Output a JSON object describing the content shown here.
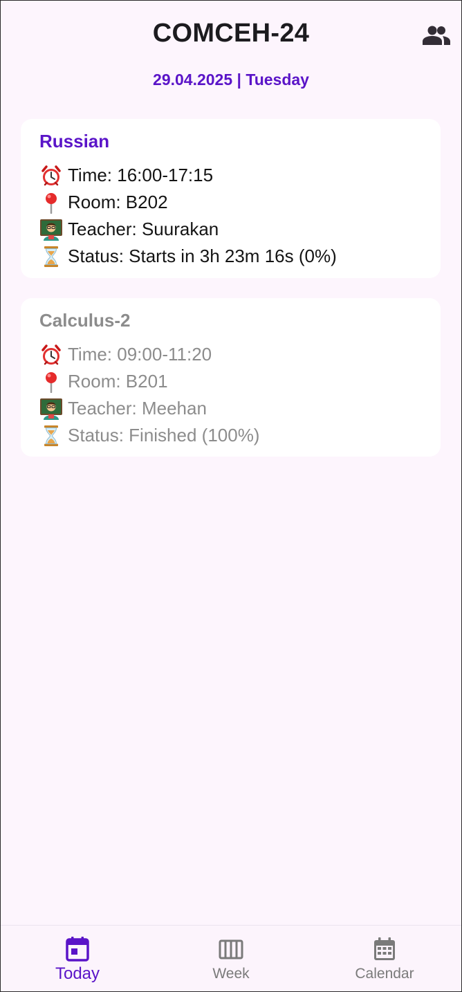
{
  "header": {
    "title": "COMCEH-24",
    "group_icon": "people-icon"
  },
  "date_line": "29.04.2025 | Tuesday",
  "lessons": [
    {
      "subject": "Russian",
      "time": "Time: 16:00-17:15",
      "room": "Room: B202",
      "teacher": "Teacher: Suurakan",
      "status": "Status: Starts in 3h 23m 16s (0%)",
      "state": "upcoming"
    },
    {
      "subject": "Calculus-2",
      "time": "Time: 09:00-11:20",
      "room": "Room: B201",
      "teacher": "Teacher: Meehan",
      "status": "Status: Finished (100%)",
      "state": "finished"
    }
  ],
  "row_icons": {
    "time": "alarm-clock-icon",
    "room": "pin-icon",
    "teacher": "teacher-icon",
    "status": "hourglass-icon"
  },
  "nav": {
    "today": "Today",
    "week": "Week",
    "calendar": "Calendar",
    "active": "today"
  },
  "colors": {
    "accent": "#5a14c8",
    "background": "#fdf5fd",
    "card": "#ffffff",
    "finished_text": "#8c8c8c",
    "nav_inactive": "#7a7a7a"
  }
}
